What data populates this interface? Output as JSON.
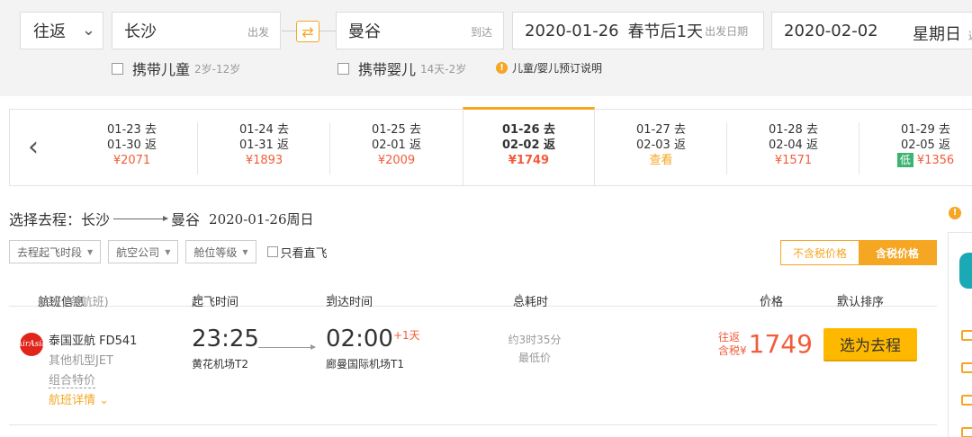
{
  "search": {
    "trip_type": "往返",
    "from_city": "长沙",
    "from_hint": "出发",
    "to_city": "曼谷",
    "to_hint": "到达",
    "depart_date": "2020-01-26",
    "depart_holiday": "春节后1天",
    "depart_hint": "出发日期",
    "return_date": "2020-02-02",
    "return_weekday": "星期日",
    "return_hint": "返",
    "child_label": "携带儿童",
    "child_age": "2岁-12岁",
    "infant_label": "携带婴儿",
    "infant_age": "14天-2岁",
    "booking_note": "儿童/婴儿预订说明"
  },
  "date_strip": [
    {
      "go": "01-23 去",
      "back": "01-30 返",
      "price": "¥2071"
    },
    {
      "go": "01-24 去",
      "back": "01-31 返",
      "price": "¥1893"
    },
    {
      "go": "01-25 去",
      "back": "02-01 返",
      "price": "¥2009"
    },
    {
      "go": "01-26 去",
      "back": "02-02 返",
      "price": "¥1749",
      "active": true
    },
    {
      "go": "01-27 去",
      "back": "02-03 返",
      "price": "查看"
    },
    {
      "go": "01-28 去",
      "back": "02-04 返",
      "price": "¥1571"
    },
    {
      "go": "01-29 去",
      "back": "02-05 返",
      "price": "¥1356",
      "badge": "低"
    }
  ],
  "section": {
    "prefix": "选择去程：长沙",
    "dest": "曼谷",
    "date": "2020-01-26周日"
  },
  "filters": {
    "time": "去程起飞时段",
    "airline": "航空公司",
    "cabin": "舱位等级",
    "direct": "只看直飞",
    "price_excl_tax": "不含税价格",
    "price_incl_tax": "含税价格"
  },
  "table_header": {
    "flight_info": "航班信息",
    "flight_count": "(共71条航班)",
    "dep_time": "起飞时间",
    "arr_time": "到达时间",
    "duration": "总耗时",
    "price": "价格",
    "sort": "默认排序"
  },
  "flight": {
    "airline": "泰国亚航 FD541",
    "aircraft": "其他机型JET",
    "combo": "组合特价",
    "details": "航班详情",
    "logo_text": "AirAsia",
    "dep_time": "23:25",
    "dep_airport": "黄花机场T2",
    "arr_time": "02:00",
    "arr_plus": "+1天",
    "arr_airport": "廊曼国际机场T1",
    "duration": "约3时35分",
    "duration_note": "最低价",
    "price_label_1": "往返",
    "price_label_2": "含税¥",
    "price": "1749",
    "select_btn": "选为去程"
  },
  "colors": {
    "accent": "#f5a623",
    "price": "#f25c3a",
    "button": "#ffb800"
  }
}
